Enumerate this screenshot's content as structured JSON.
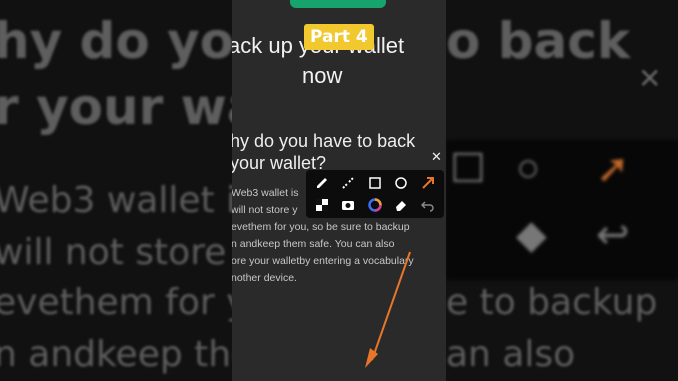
{
  "badge": "Part 4",
  "title": {
    "line1": "ack up your wallet",
    "line2": "now"
  },
  "heading": {
    "line1": "hy do you have to back",
    "line2": "your wallet?"
  },
  "body": [
    "Web3 wallet is",
    "will not store y",
    "evethem for you, so be sure to backup",
    "n andkeep them safe. You can also",
    "ore your walletby entering a vocabulary",
    "nother device."
  ],
  "background": {
    "left": [
      "hy do you",
      "r your wa",
      "Web3 wallet is",
      "will not store y",
      "evethem for yo",
      "n andkeep the"
    ],
    "right": [
      "o back",
      "e to backup",
      "an also"
    ]
  },
  "toolbar": {
    "icons": [
      "pen-icon",
      "highlighter-icon",
      "rectangle-icon",
      "circle-icon",
      "arrow-icon",
      "mosaic-icon",
      "camera-icon",
      "color-picker-icon",
      "eraser-icon",
      "undo-icon"
    ]
  },
  "colors": {
    "badge": "#f1c82e",
    "accent": "#17a36c",
    "arrow": "#e8752a"
  }
}
